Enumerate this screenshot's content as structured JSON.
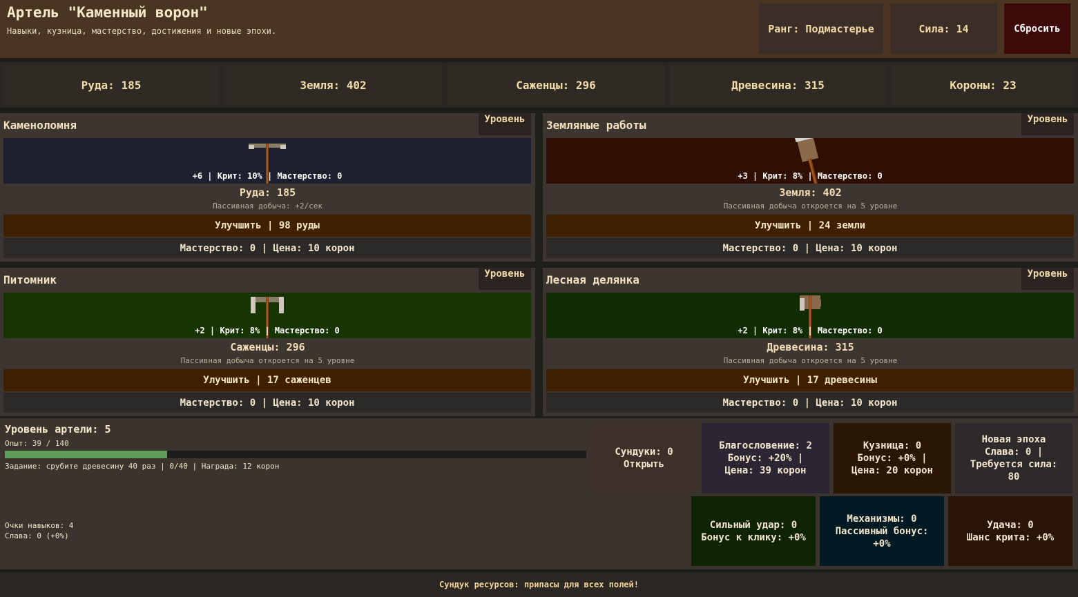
{
  "header": {
    "title": "Артель \"Каменный ворон\"",
    "subtitle": "Навыки, кузница, мастерство, достижения и новые эпохи.",
    "rank": "Ранг: Подмастерье",
    "power": "Сила: 14",
    "reset_label": "Сбросить"
  },
  "resources": [
    "Руда: 185",
    "Земля: 402",
    "Саженцы: 296",
    "Древесина: 315",
    "Короны: 23"
  ],
  "fields": [
    {
      "title": "Каменоломня",
      "level_label": "Уровень",
      "color": "#1e2030",
      "tool": "pickaxe-icon",
      "stats": "+6 | Крит: 10% | Мастерство: 0",
      "amount": "Руда: 185",
      "passive": "Пассивная добыча: +2/сек",
      "upgrade": "Улучшить | 98 руды",
      "mastery": "Мастерство: 0 | Цена: 10 корон"
    },
    {
      "title": "Земляные работы",
      "level_label": "Уровень",
      "color": "#2e0f02",
      "tool": "shovel-icon",
      "stats": "+3 | Крит: 8% | Мастерство: 0",
      "amount": "Земля: 402",
      "passive": "Пассивная добыча откроется на 5 уровне",
      "upgrade": "Улучшить | 24 земли",
      "mastery": "Мастерство: 0 | Цена: 10 корон"
    },
    {
      "title": "Питомник",
      "level_label": "Уровень",
      "color": "#173502",
      "tool": "hoe-icon",
      "stats": "+2 | Крит: 8% | Мастерство: 0",
      "amount": "Саженцы: 296",
      "passive": "Пассивная добыча откроется на 5 уровне",
      "upgrade": "Улучшить | 17 саженцев",
      "mastery": "Мастерство: 0 | Цена: 10 корон"
    },
    {
      "title": "Лесная делянка",
      "level_label": "Уровень",
      "color": "#112c02",
      "tool": "axe-icon",
      "stats": "+2 | Крит: 8% | Мастерство: 0",
      "amount": "Древесина: 315",
      "passive": "Пассивная добыча откроется на 5 уровне",
      "upgrade": "Улучшить | 17 древесины",
      "mastery": "Мастерство: 0 | Цена: 10 корон"
    }
  ],
  "artel": {
    "level": "Уровень артели: 5",
    "exp": "Опыт: 39 / 140",
    "exp_progress": 0.279,
    "task": "Задание: срубите древесину 40 раз | 0/40 | Награда: 12 корон",
    "skill_points": "Очки навыков: 4",
    "glory": "Слава: 0 (+0%)"
  },
  "cards_top": [
    {
      "lines": [
        "Сундуки: 0",
        "Открыть"
      ],
      "color": "#3c3028"
    },
    {
      "lines": [
        "Благословение: 2",
        "Бонус: +20% |",
        "Цена: 39 корон"
      ],
      "color": "#2c2634"
    },
    {
      "lines": [
        "Кузница: 0",
        "Бонус: +0% |",
        "Цена: 20 корон"
      ],
      "color": "#2a1604"
    },
    {
      "lines": [
        "Новая эпоха",
        "Слава: 0 |",
        "Требуется сила:",
        "80"
      ],
      "color": "#2e2a2c"
    }
  ],
  "cards_bottom": [
    {
      "lines": [
        "Сильный удар: 0",
        "Бонус к клику: +0%"
      ],
      "color": "#0e2402"
    },
    {
      "lines": [
        "Механизмы: 0",
        "Пассивный бонус:",
        "+0%"
      ],
      "color": "#021a24"
    },
    {
      "lines": [
        "Удача: 0",
        "Шанс крита: +0%"
      ],
      "color": "#2a1408"
    }
  ],
  "footer": "Сундук ресурсов: припасы для всех полей!"
}
